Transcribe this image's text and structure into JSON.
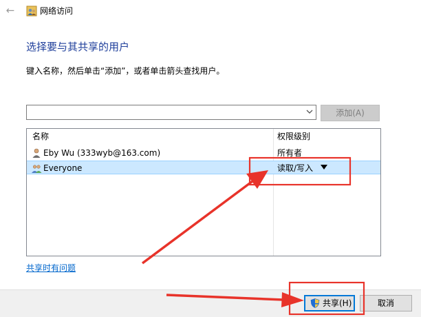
{
  "window": {
    "title": "网络访问",
    "back_icon": "back-arrow-icon",
    "title_icon": "network-users-icon"
  },
  "main": {
    "heading": "选择要与其共享的用户",
    "instruction": "键入名称，然后单击“添加”，或者单击箭头查找用户。",
    "user_input": {
      "value": "",
      "placeholder": ""
    },
    "add_button": "添加(A)"
  },
  "list": {
    "headers": {
      "name": "名称",
      "permission": "权限级别"
    },
    "rows": [
      {
        "name": "Eby Wu (333wyb@163.com)",
        "permission": "所有者",
        "icon": "user-icon",
        "selected": false
      },
      {
        "name": "Everyone",
        "permission": "读取/写入",
        "icon": "group-icon",
        "selected": true
      }
    ]
  },
  "help_link": "共享时有问题",
  "footer": {
    "share_button": "共享(H)",
    "cancel_button": "取消"
  },
  "colors": {
    "heading": "#1f3f9b",
    "link": "#0066cc",
    "selection": "#cce8ff",
    "annotation": "#e8332a"
  }
}
